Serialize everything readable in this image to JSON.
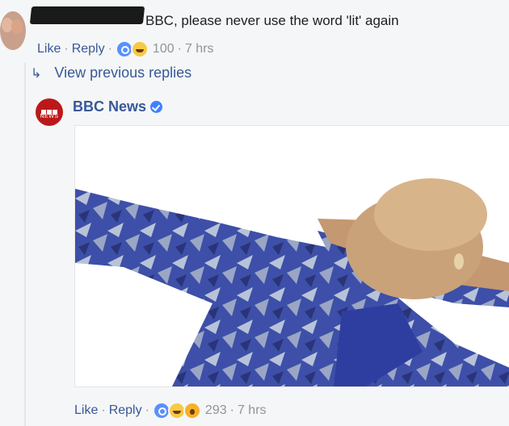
{
  "comment": {
    "text": "BBC, please never use the word 'lit' again",
    "actions": {
      "like": "Like",
      "reply": "Reply",
      "count": "100",
      "time": "7 hrs",
      "sep": "·"
    },
    "reactions": [
      "like-icon",
      "haha-icon"
    ]
  },
  "thread": {
    "view_previous": "View previous replies"
  },
  "reply": {
    "author": "BBC News",
    "avatar_label": "NEWS",
    "actions": {
      "like": "Like",
      "reply": "Reply",
      "count": "293",
      "time": "7 hrs",
      "sep": "·"
    },
    "reactions": [
      "like-icon",
      "haha-icon",
      "wow-icon"
    ]
  },
  "colors": {
    "link": "#385898",
    "meta": "#90949c",
    "bbc_red": "#bb1919",
    "verified": "#4080ff"
  }
}
